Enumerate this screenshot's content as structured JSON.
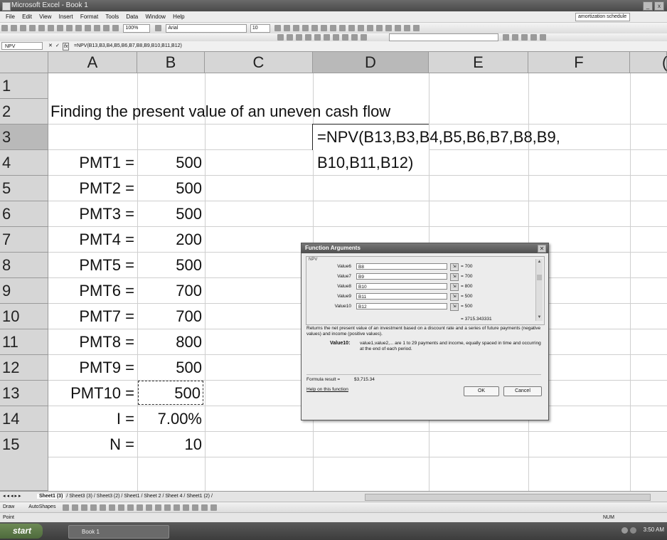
{
  "window": {
    "title": "Microsoft Excel - Book 1"
  },
  "menu": {
    "items": [
      "File",
      "Edit",
      "View",
      "Insert",
      "Format",
      "Tools",
      "Data",
      "Window",
      "Help"
    ],
    "ask_box": "amortization schedule"
  },
  "toolbar": {
    "zoom": "100%",
    "font": "Arial",
    "font_size": "10"
  },
  "formula_bar": {
    "name_box": "NPV",
    "fx_label": "fx",
    "formula": "=NPV(B13,B3,B4,B5,B6,B7,B8,B9,B10,B11,B12)"
  },
  "grid": {
    "columns": [
      "A",
      "B",
      "C",
      "D",
      "E",
      "F",
      "("
    ],
    "rows": [
      "1",
      "2",
      "3",
      "4",
      "5",
      "6",
      "7",
      "8",
      "9",
      "10",
      "11",
      "12",
      "13",
      "14",
      "15"
    ],
    "title": "Finding the present value of an uneven cash flow",
    "labels": [
      "PMT1 =",
      "PMT2 =",
      "PMT3 =",
      "PMT4 =",
      "PMT5 =",
      "PMT6 =",
      "PMT7 =",
      "PMT8 =",
      "PMT9 =",
      "PMT10 =",
      "I =",
      "N ="
    ],
    "values": [
      "500",
      "500",
      "500",
      "200",
      "500",
      "700",
      "700",
      "800",
      "500",
      "500",
      "7.00%",
      "10"
    ],
    "d3_line1": "=NPV(B13,B3,B4,B5,B6,B7,B8,B9,",
    "d3_line2": "B10,B11,B12)"
  },
  "dialog": {
    "title": "Function Arguments",
    "function_name": "NPV",
    "args": [
      {
        "label": "Value6",
        "ref": "B8",
        "result": "= 700"
      },
      {
        "label": "Value7",
        "ref": "B9",
        "result": "= 700"
      },
      {
        "label": "Value8",
        "ref": "B10",
        "result": "= 800"
      },
      {
        "label": "Value9",
        "ref": "B11",
        "result": "= 500"
      },
      {
        "label": "Value10",
        "ref": "B12",
        "result": "= 500"
      }
    ],
    "total": "= 3715.343331",
    "description": "Returns the net present value of an investment based on a discount rate and a series of future payments (negative values) and income (positive values).",
    "arg_help_label": "Value10:",
    "arg_help_text": "value1,value2,... are 1 to 29 payments and income, equally spaced in time and occurring at the end of each period.",
    "formula_result_label": "Formula result =",
    "formula_result_value": "$3,715.34",
    "help_link": "Help on this function",
    "ok_label": "OK",
    "cancel_label": "Cancel"
  },
  "sheet_tabs": [
    "Sheet1 (3)",
    "Sheet3 (3)",
    "Sheet3 (2)",
    "Sheet1",
    "Sheet 2",
    "Sheet 4",
    "Sheet1 (2)"
  ],
  "draw_bar": {
    "draw_label": "Draw",
    "autoshapes_label": "AutoShapes"
  },
  "status": {
    "mode": "Point",
    "num": "NUM"
  },
  "taskbar": {
    "start": "start",
    "item": "Book 1",
    "clock": "3:50 AM"
  }
}
